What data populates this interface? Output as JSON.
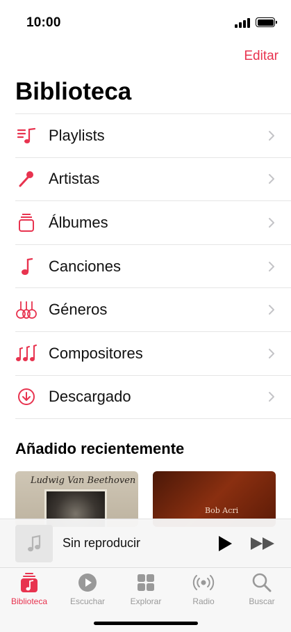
{
  "status_bar": {
    "time": "10:00"
  },
  "header": {
    "edit_label": "Editar",
    "title": "Biblioteca"
  },
  "menu": {
    "items": [
      {
        "label": "Playlists",
        "icon": "playlist-icon"
      },
      {
        "label": "Artistas",
        "icon": "microphone-icon"
      },
      {
        "label": "Álbumes",
        "icon": "album-stack-icon"
      },
      {
        "label": "Canciones",
        "icon": "music-note-icon"
      },
      {
        "label": "Géneros",
        "icon": "guitars-icon"
      },
      {
        "label": "Compositores",
        "icon": "notes-icon"
      },
      {
        "label": "Descargado",
        "icon": "download-circle-icon"
      }
    ]
  },
  "recent": {
    "title": "Añadido recientemente",
    "albums": [
      {
        "cover_text": "Ludwig Van Beethoven"
      },
      {
        "cover_text": "Bob Acri"
      }
    ]
  },
  "player": {
    "status": "Sin reproducir"
  },
  "tabs": [
    {
      "label": "Biblioteca",
      "icon": "library-icon",
      "active": true
    },
    {
      "label": "Escuchar",
      "icon": "play-circle-icon",
      "active": false
    },
    {
      "label": "Explorar",
      "icon": "grid-icon",
      "active": false
    },
    {
      "label": "Radio",
      "icon": "radio-icon",
      "active": false
    },
    {
      "label": "Buscar",
      "icon": "search-icon",
      "active": false
    }
  ],
  "colors": {
    "accent": "#e8334f",
    "inactive": "#999999"
  }
}
